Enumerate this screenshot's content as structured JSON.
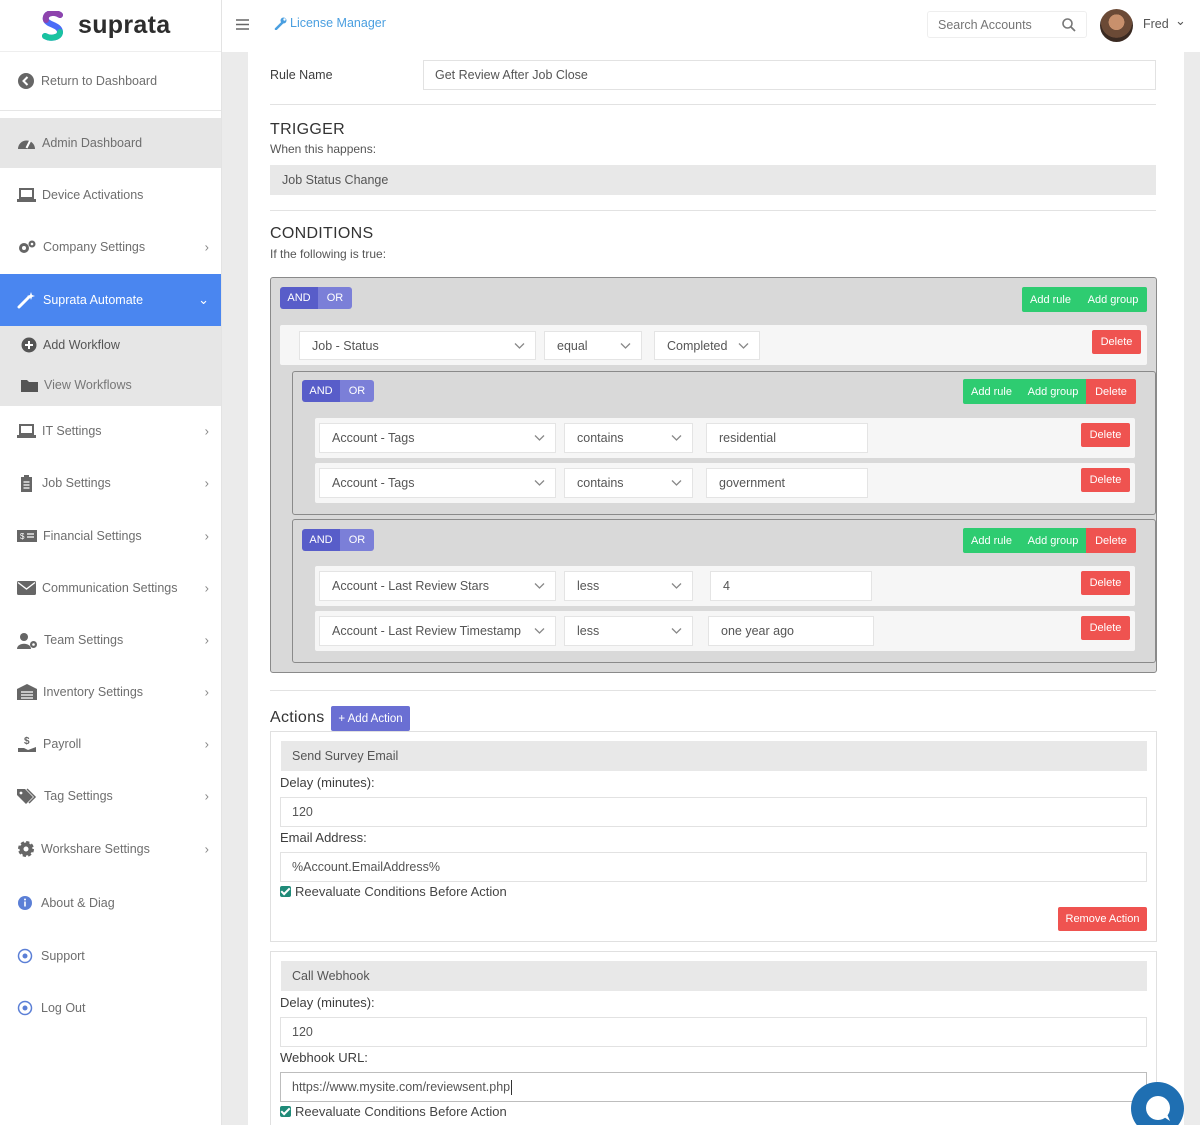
{
  "app": {
    "brand": "suprata",
    "brand_color": "#4a6cf7"
  },
  "topbar": {
    "breadcrumb": "License Manager",
    "search_placeholder": "Search Accounts",
    "user_name": "Fred"
  },
  "sidebar": {
    "return_label": "Return to Dashboard",
    "items": [
      {
        "label": "Admin Dashboard",
        "icon": "gauge-icon"
      },
      {
        "label": "Device Activations",
        "icon": "laptop-icon"
      },
      {
        "label": "Company Settings",
        "icon": "cogs-icon"
      },
      {
        "label": "Suprata Automate",
        "icon": "magic-wand-icon"
      },
      {
        "label": "Add Workflow",
        "icon": "plus-circle-icon"
      },
      {
        "label": "View Workflows",
        "icon": "folder-icon"
      },
      {
        "label": "IT Settings",
        "icon": "laptop-icon"
      },
      {
        "label": "Job Settings",
        "icon": "clipboard-icon"
      },
      {
        "label": "Financial Settings",
        "icon": "money-icon"
      },
      {
        "label": "Communication Settings",
        "icon": "envelope-icon"
      },
      {
        "label": "Team Settings",
        "icon": "users-cog-icon"
      },
      {
        "label": "Inventory Settings",
        "icon": "warehouse-icon"
      },
      {
        "label": "Payroll",
        "icon": "hand-dollar-icon"
      },
      {
        "label": "Tag Settings",
        "icon": "tags-icon"
      },
      {
        "label": "Workshare Settings",
        "icon": "cog-icon"
      },
      {
        "label": "About & Diag",
        "icon": "info-icon"
      },
      {
        "label": "Support",
        "icon": "life-ring-icon"
      },
      {
        "label": "Log Out",
        "icon": "power-icon"
      }
    ]
  },
  "rule": {
    "name_label": "Rule Name",
    "name_value": "Get Review After Job Close"
  },
  "trigger": {
    "title": "TRIGGER",
    "subtitle": "When this happens:",
    "value": "Job Status Change"
  },
  "conditions": {
    "title": "CONDITIONS",
    "subtitle": "If the following is true:",
    "and_label": "AND",
    "or_label": "OR",
    "add_rule": "Add rule",
    "add_group": "Add group",
    "delete": "Delete",
    "top_rule": {
      "field": "Job - Status",
      "op": "equal",
      "value": "Completed"
    },
    "group1": [
      {
        "field": "Account - Tags",
        "op": "contains",
        "value": "residential"
      },
      {
        "field": "Account - Tags",
        "op": "contains",
        "value": "government"
      }
    ],
    "group2": [
      {
        "field": "Account - Last Review Stars",
        "op": "less",
        "value": "4"
      },
      {
        "field": "Account - Last Review Timestamp",
        "op": "less",
        "value": "one year ago"
      }
    ]
  },
  "actions": {
    "title": "Actions",
    "add_action": "+ Add Action",
    "delay_label": "Delay (minutes):",
    "reevaluate": "Reevaluate Conditions Before Action",
    "remove": "Remove Action",
    "action1": {
      "type": "Send Survey Email",
      "delay": "120",
      "field_label": "Email Address:",
      "field_value": "%Account.EmailAddress%"
    },
    "action2": {
      "type": "Call Webhook",
      "delay": "120",
      "field_label": "Webhook URL:",
      "field_value": "https://www.mysite.com/reviewsent.php"
    }
  }
}
